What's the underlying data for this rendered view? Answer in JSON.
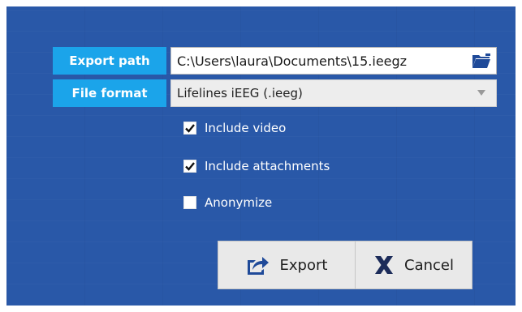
{
  "export_path": {
    "label": "Export path",
    "value": "C:\\Users\\laura\\Documents\\15.ieegz",
    "icon": "folder-icon"
  },
  "file_format": {
    "label": "File format",
    "selected": "Lifelines iEEG (.ieeg)",
    "icon": "chevron-down-icon"
  },
  "options": {
    "include_video": {
      "label": "Include video",
      "checked": true
    },
    "include_attachments": {
      "label": "Include attachments",
      "checked": true
    },
    "anonymize": {
      "label": "Anonymize",
      "checked": false
    }
  },
  "buttons": {
    "export": {
      "label": "Export",
      "icon": "export-icon"
    },
    "cancel": {
      "label": "Cancel",
      "icon": "close-icon"
    }
  },
  "colors": {
    "background": "#2958a8",
    "label_accent": "#1ba4ea",
    "button_bg": "#e9e9e9",
    "icon_blue": "#1f4a99",
    "icon_navy": "#1c2c5a"
  }
}
